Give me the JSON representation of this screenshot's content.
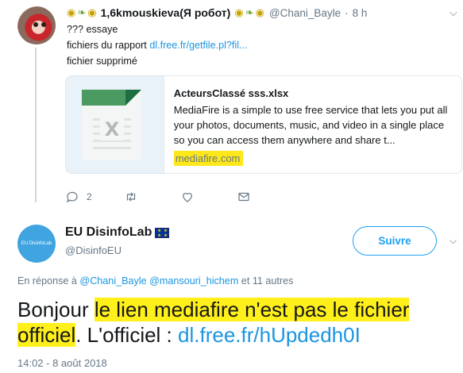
{
  "tweet1": {
    "decor_left": [
      "bee",
      "leaf",
      "bee"
    ],
    "decor_right": [
      "bee",
      "leaf",
      "bee"
    ],
    "name": "1,6kmouskieva(Я робот)",
    "handle": "@Chani_Bayle",
    "dot": "·",
    "time": "8 h",
    "line1": "??? essaye",
    "line2_prefix": "fichiers du rapport ",
    "line2_link": "dl.free.fr/getfile.pl?fil...",
    "line3": "fichier supprimé",
    "card": {
      "title": "ActeursClassé sss.xlsx",
      "description": "MediaFire is a simple to use free service that lets you put all your photos, documents, music, and video in a single place so you can access them anywhere and share t...",
      "domain": "mediafire.com",
      "thumb_icon": "xlsx-file-icon",
      "thumb_letter": "X"
    },
    "actions": {
      "reply_count": "2",
      "retweet_count": "",
      "like_count": ""
    }
  },
  "tweet2": {
    "avatar_text": "EU DisinfoLab",
    "name": "EU DisinfoLab",
    "handle": "@DisinfoEU",
    "follow_label": "Suivre",
    "reply_prefix": "En réponse à ",
    "reply_user1": "@Chani_Bayle",
    "reply_user2": "@mansouri_hichem",
    "reply_suffix": " et 11 autres",
    "text": {
      "part1": "Bonjour ",
      "highlight1": "le lien mediafire n'est pas le fichier",
      "highlight2": "officiel",
      "after_highlight": ". L'officiel :  ",
      "link": "dl.free.fr/hUpdedh0I"
    },
    "timestamp": "14:02 - 8 août 2018"
  },
  "colors": {
    "link": "#1b95e0",
    "highlight": "#ffef1a",
    "muted": "#657786",
    "follow": "#1da1f2"
  }
}
